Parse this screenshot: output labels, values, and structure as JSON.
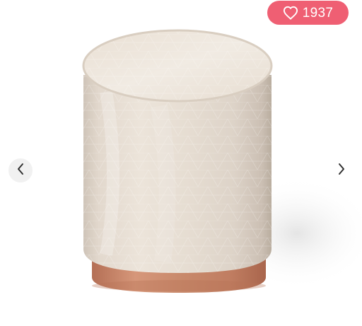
{
  "like_badge": {
    "count": "1937",
    "icon": "heart-outline-icon",
    "color": "#ef5f73"
  },
  "gallery": {
    "prev_icon": "chevron-left-icon",
    "next_icon": "chevron-right-icon"
  },
  "product_image": {
    "subject": "velvet-round-pouf-stool",
    "body_color": "#e6ddd2",
    "base_color": "#c48467"
  }
}
